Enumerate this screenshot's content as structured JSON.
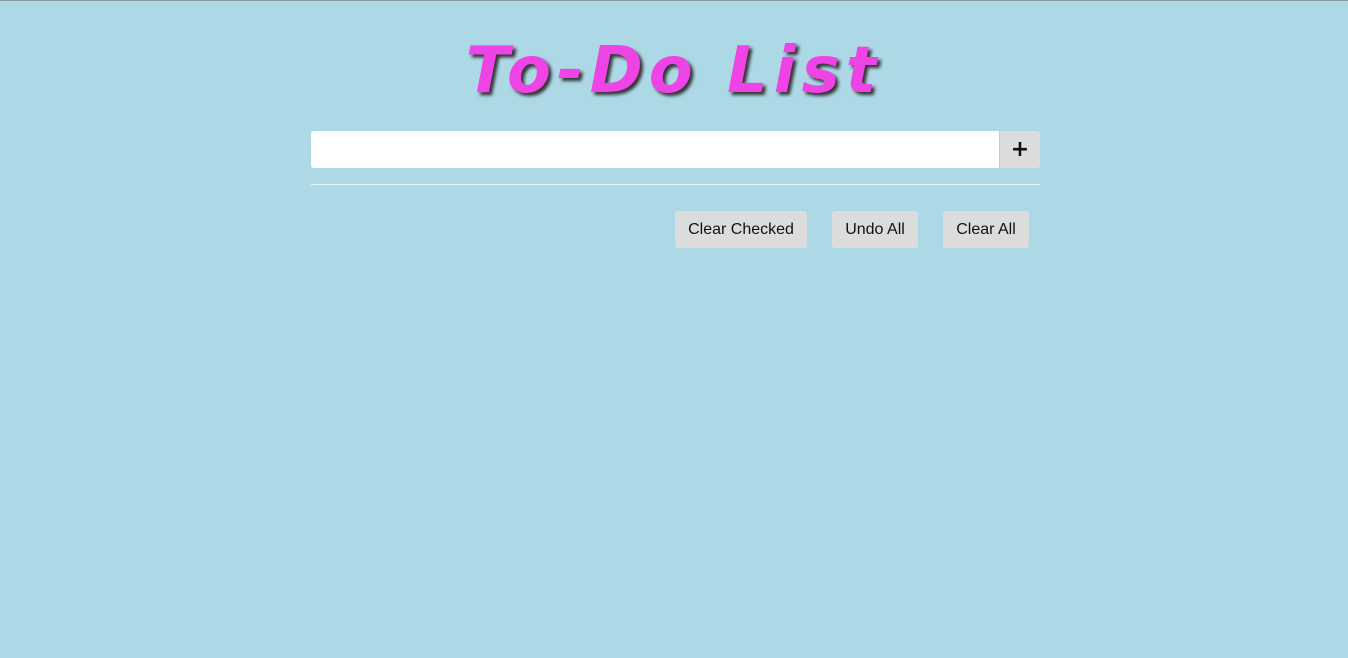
{
  "page": {
    "title": "To-Do List"
  },
  "task_input": {
    "value": "",
    "placeholder": ""
  },
  "add_button": {
    "label": "+"
  },
  "actions": {
    "clear_checked_label": "Clear Checked",
    "undo_all_label": "Undo All",
    "clear_all_label": "Clear All"
  },
  "colors": {
    "background": "#add8e6",
    "title": "#ee44e6",
    "button": "#dcdcdc"
  }
}
